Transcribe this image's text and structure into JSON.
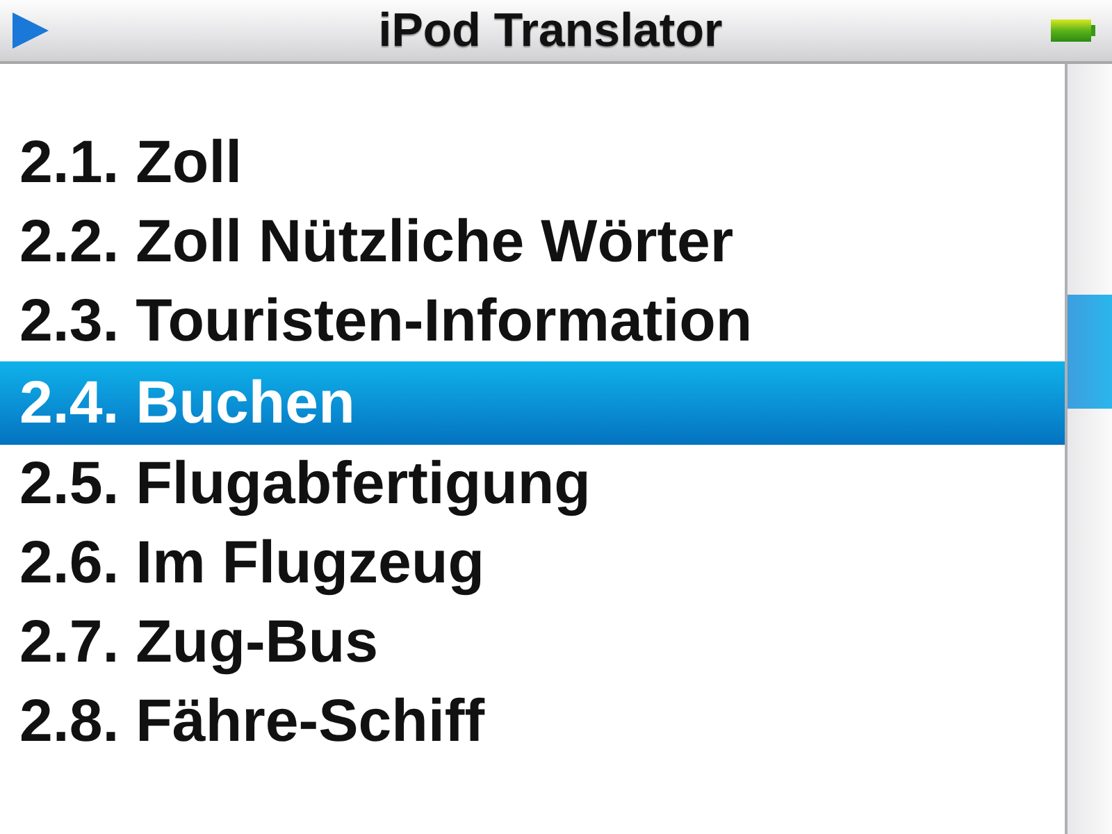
{
  "window": {
    "title": "iPod Translator"
  },
  "menu": {
    "items": [
      {
        "label": "2.1. Zoll",
        "selected": false
      },
      {
        "label": "2.2. Zoll Nützliche Wörter",
        "selected": false
      },
      {
        "label": "2.3. Touristen-Information",
        "selected": false
      },
      {
        "label": "2.4. Buchen",
        "selected": true
      },
      {
        "label": "2.5. Flugabfertigung",
        "selected": false
      },
      {
        "label": "2.6. Im Flugzeug",
        "selected": false
      },
      {
        "label": "2.7. Zug-Bus",
        "selected": false
      },
      {
        "label": "2.8. Fähre-Schiff",
        "selected": false
      }
    ]
  }
}
